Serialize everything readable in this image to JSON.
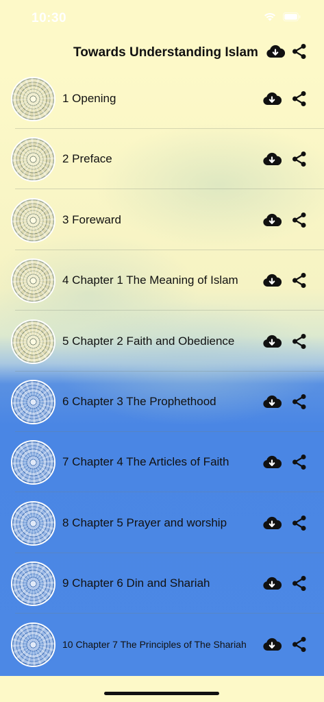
{
  "status_bar": {
    "time": "10:30"
  },
  "header": {
    "title": "Towards Understanding Islam"
  },
  "items": [
    {
      "label": "1 Opening",
      "theme": "yellow"
    },
    {
      "label": "2 Preface",
      "theme": "yellow"
    },
    {
      "label": "3 Foreward",
      "theme": "yellow"
    },
    {
      "label": "4 Chapter 1 The Meaning of Islam",
      "theme": "yellow"
    },
    {
      "label": "5 Chapter 2 Faith and Obedience",
      "theme": "yellow"
    },
    {
      "label": "6 Chapter 3 The Prophethood",
      "theme": "blue"
    },
    {
      "label": "7 Chapter 4 The Articles of Faith",
      "theme": "blue"
    },
    {
      "label": "8 Chapter 5 Prayer and worship",
      "theme": "blue"
    },
    {
      "label": "9 Chapter 6 Din and Shariah",
      "theme": "blue"
    },
    {
      "label": "10 Chapter 7 The Principles of The Shariah",
      "theme": "blue"
    }
  ],
  "icons": {
    "download": "cloud-download-icon",
    "share": "share-icon",
    "wifi": "wifi-icon",
    "battery": "battery-icon"
  },
  "colors": {
    "background_top": "#fdf9c8",
    "background_bottom": "#4c88e5",
    "text": "#111111"
  }
}
